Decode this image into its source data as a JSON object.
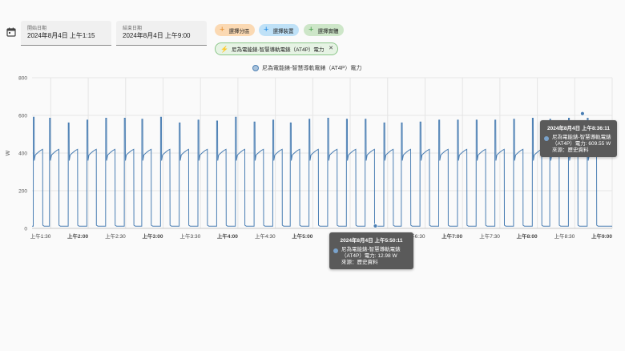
{
  "filters": {
    "start": {
      "label": "開始日期",
      "value": "2024年8月4日 上午1:15"
    },
    "end": {
      "label": "結束日期",
      "value": "2024年8月4日 上午9:00"
    },
    "chips": [
      {
        "label": "選擇分區"
      },
      {
        "label": "選擇裝置"
      },
      {
        "label": "選擇實體"
      }
    ],
    "selected_entity": "尼為電能錶-智慧導軌電錶（AT4P）電力"
  },
  "colors": {
    "series": "#4a7eb3",
    "grid": "#e5e5e5",
    "tooltip_bg": "#5a5a5a"
  },
  "chart_data": {
    "type": "line",
    "ylabel": "W",
    "ylim": [
      0,
      800
    ],
    "yticks": [
      "0",
      "200",
      "400",
      "600",
      "800"
    ],
    "xticks": [
      "上午1:30",
      "上午2:00",
      "上午2:30",
      "上午3:00",
      "上午3:30",
      "上午4:00",
      "上午4:30",
      "上午5:00",
      "上午5:30",
      "上午6:00",
      "上午6:30",
      "上午7:00",
      "上午7:30",
      "上午8:00",
      "上午8:30",
      "上午9:00"
    ],
    "xtick_bold": [
      false,
      true,
      false,
      true,
      false,
      true,
      false,
      true,
      false,
      true,
      false,
      true,
      false,
      true,
      false,
      true
    ],
    "x_start": "01:15",
    "x_end": "09:00",
    "series": [
      {
        "name": "尼為電能錶-智慧導軌電錶（AT4P）電力",
        "cycle_starts": [
          "01:16",
          "01:29",
          "01:44",
          "01:59",
          "02:14",
          "02:29",
          "02:43",
          "02:58",
          "03:13",
          "03:28",
          "03:43",
          "03:58",
          "04:13",
          "04:28",
          "04:42",
          "04:57",
          "05:12",
          "05:27",
          "05:42",
          "05:57",
          "06:11",
          "06:26",
          "06:41",
          "06:56",
          "07:11",
          "07:26",
          "07:41",
          "07:56",
          "08:10",
          "08:25",
          "08:40"
        ],
        "cycle_peaks": [
          590,
          585,
          560,
          575,
          585,
          585,
          580,
          590,
          560,
          575,
          570,
          590,
          565,
          575,
          560,
          580,
          585,
          580,
          580,
          560,
          560,
          565,
          575,
          575,
          575,
          575,
          580,
          585,
          580,
          585,
          585
        ],
        "plateau_w": 400,
        "idle_w": 12,
        "on_minutes": 7.5
      }
    ],
    "annotations": [
      {
        "time_text": "2024年8月4日 上午8:36:11",
        "x": "08:36:11",
        "y": 609.55,
        "lines": [
          "尼為電能錶-智慧導軌電錶",
          "（AT4P）電力: 609.55 W",
          "來源：歷史資料"
        ]
      },
      {
        "time_text": "2024年8月4日 上午5:50:11",
        "x": "05:50:11",
        "y": 12.98,
        "lines": [
          "尼為電能錶-智慧導軌電錶",
          "（AT4P）電力: 12.98 W",
          "來源：歷史資料"
        ]
      }
    ]
  }
}
